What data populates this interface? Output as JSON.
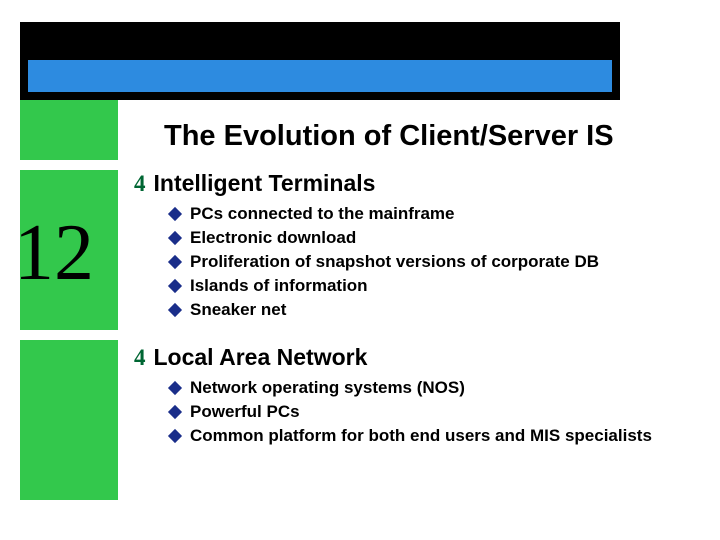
{
  "slide_number": "12",
  "title": "The Evolution of Client/Server IS",
  "topics": [
    {
      "number": "4",
      "heading": "Intelligent Terminals",
      "items": [
        "PCs connected to the mainframe",
        "Electronic download",
        "Proliferation of snapshot versions of corporate DB",
        "Islands of information",
        "Sneaker net"
      ]
    },
    {
      "number": "4",
      "heading": "Local Area Network",
      "items": [
        "Network operating systems (NOS)",
        "Powerful PCs",
        "Common platform for both end users and MIS specialists"
      ]
    }
  ]
}
